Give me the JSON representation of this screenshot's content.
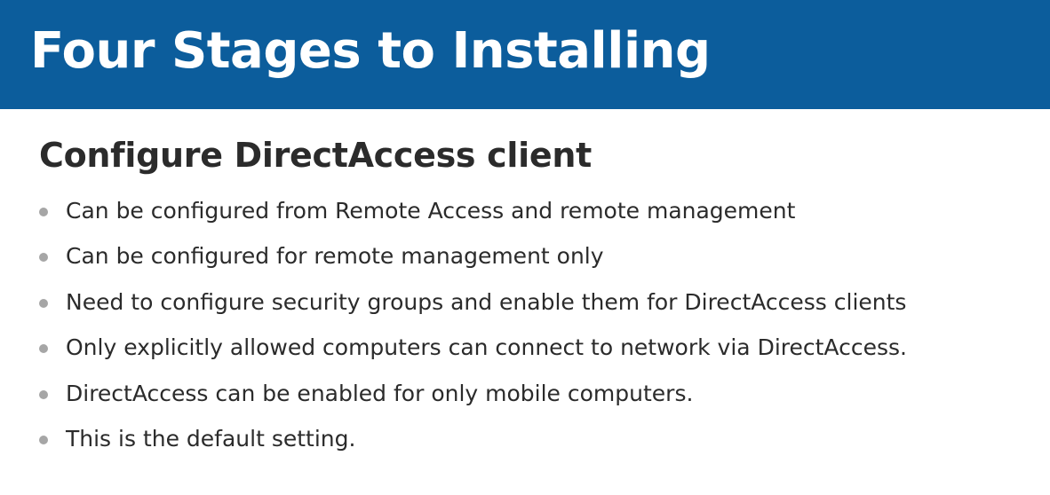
{
  "header": {
    "title": "Four Stages to Installing"
  },
  "content": {
    "subtitle": "Configure DirectAccess client",
    "bullets": [
      "Can be configured from Remote Access and remote management",
      "Can be configured for remote management only",
      "Need to configure security groups and enable them for DirectAccess clients",
      "Only explicitly allowed computers can connect to network via DirectAccess.",
      "DirectAccess can be enabled for only mobile computers.",
      "This is the default setting."
    ]
  },
  "colors": {
    "title_bar": "#0c5d9c",
    "title_text": "#ffffff",
    "body_text": "#2b2b2b",
    "bullet": "#a6a6a6"
  }
}
